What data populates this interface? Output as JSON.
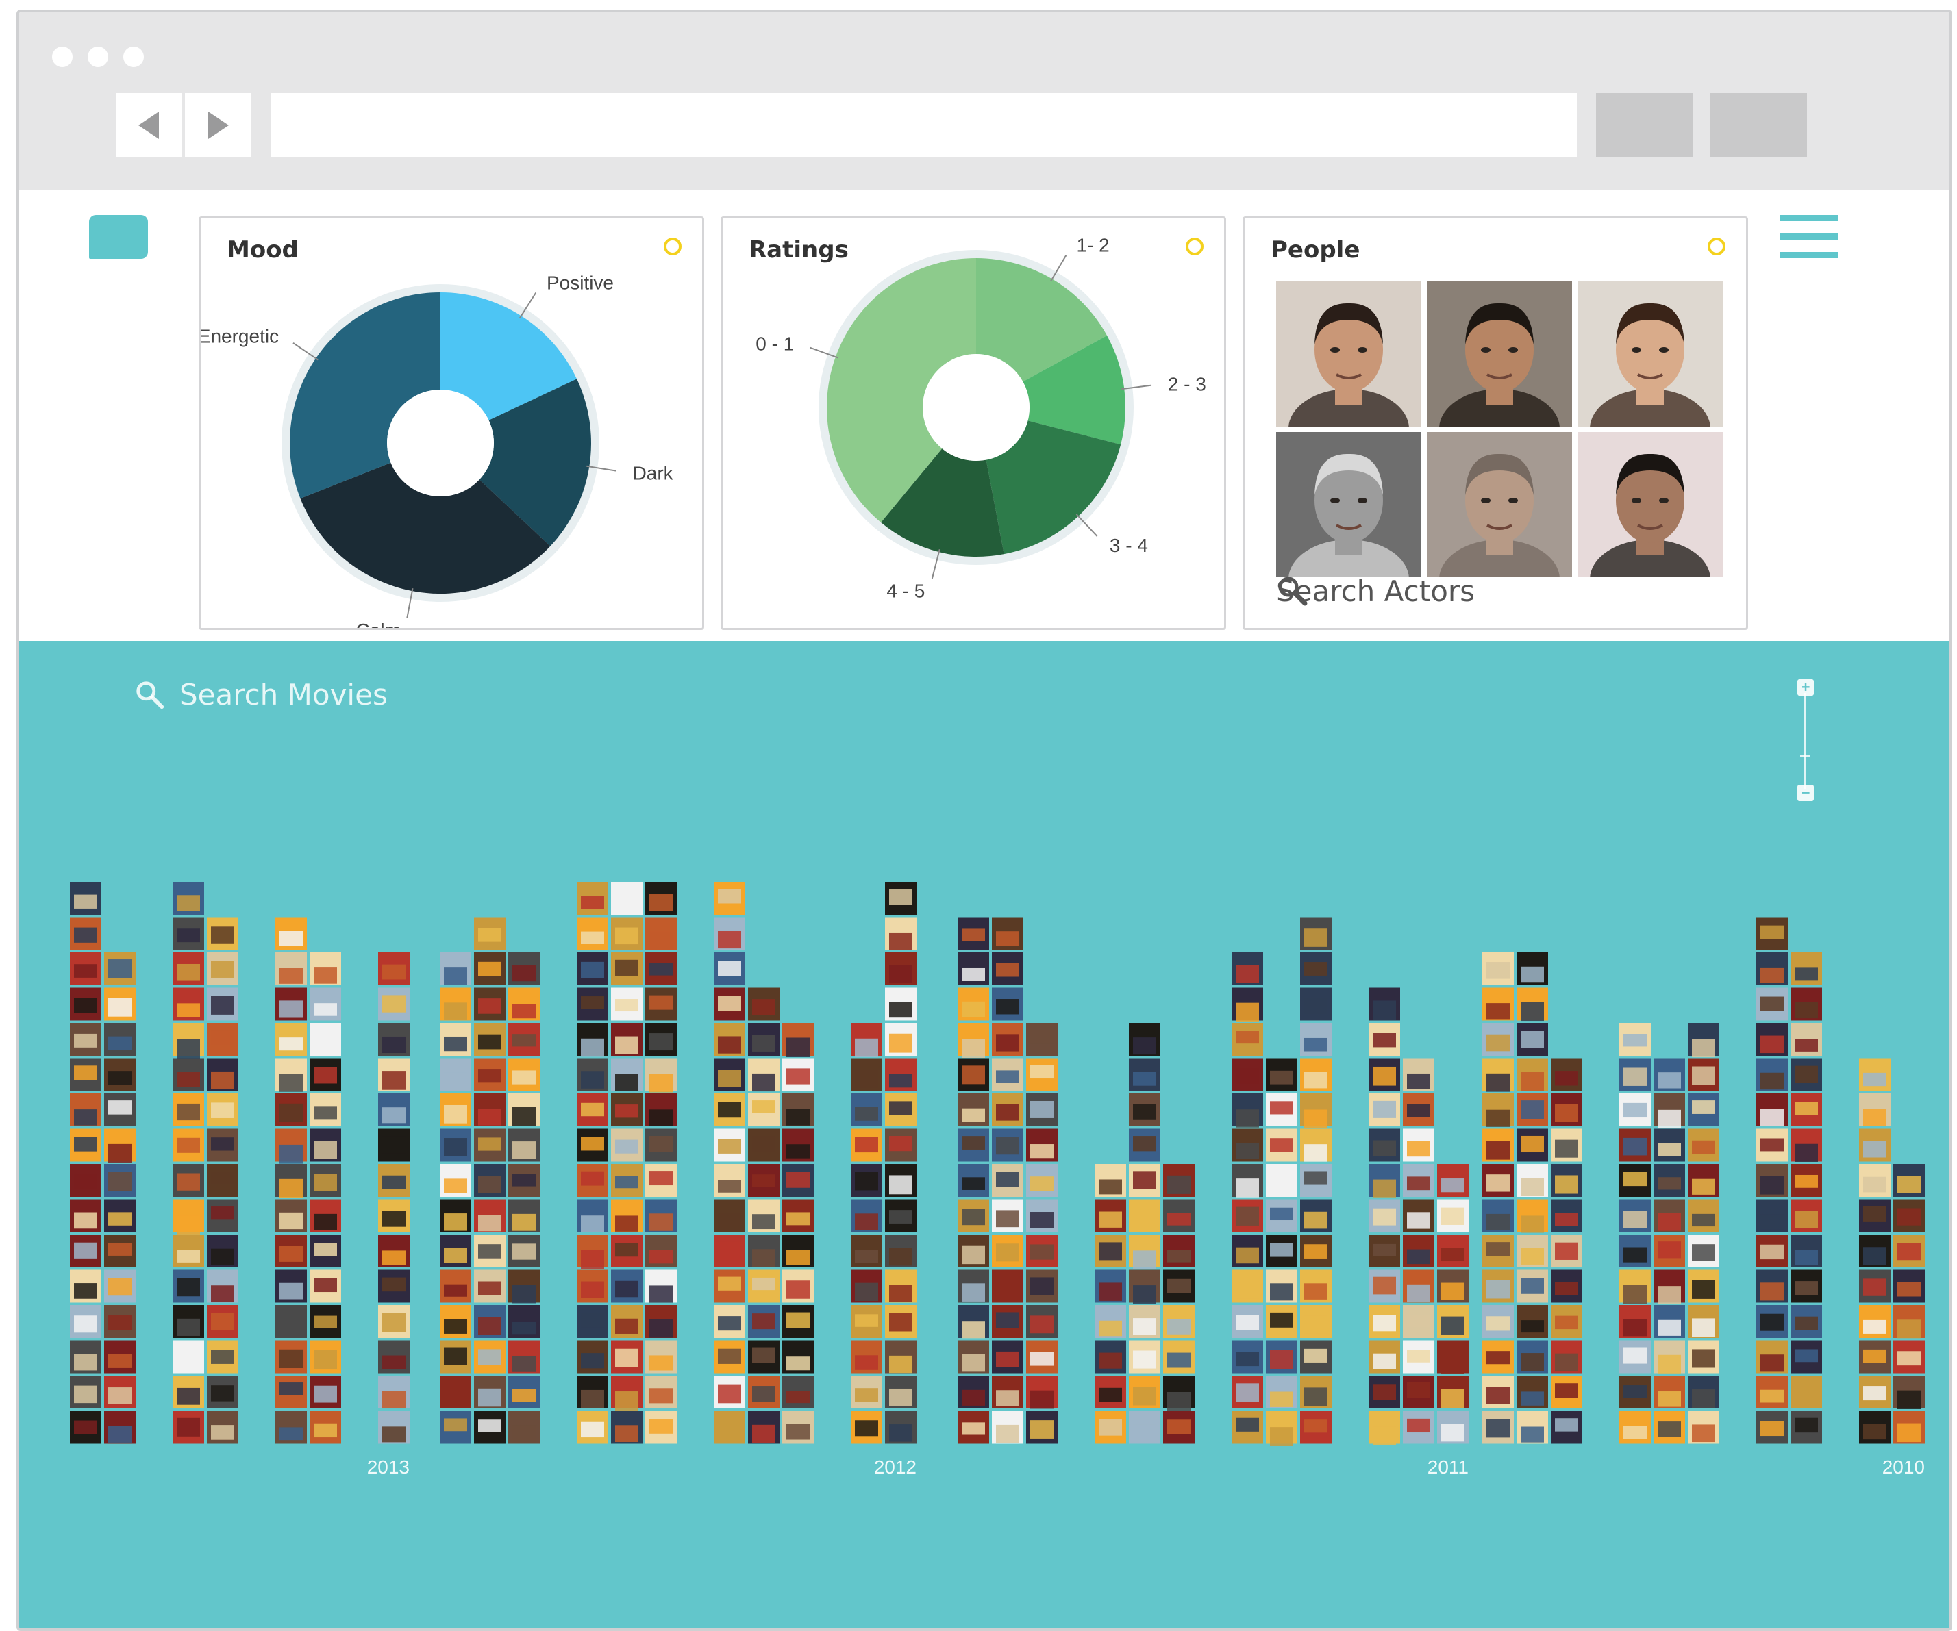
{
  "colors": {
    "teal": "#62c6cb",
    "chrome_bg": "#e6e6e7",
    "ring_yellow": "#f4d11d"
  },
  "browser": {
    "back_icon": "back-arrow-icon",
    "forward_icon": "forward-arrow-icon",
    "url_value": ""
  },
  "panels": {
    "mood": {
      "title": "Mood",
      "chart_data": {
        "type": "pie",
        "labels": [
          "Positive",
          "Dark",
          "Calm",
          "Energetic"
        ],
        "values": [
          18,
          19,
          32,
          31
        ],
        "colors": [
          "#4dc5f4",
          "#1b4a5a",
          "#1b2b35",
          "#24647e"
        ]
      }
    },
    "ratings": {
      "title": "Ratings",
      "chart_data": {
        "type": "pie",
        "labels": [
          "1- 2",
          "2 - 3",
          "3 - 4",
          "4 - 5",
          "0 - 1"
        ],
        "values": [
          17,
          12,
          18,
          14,
          39
        ],
        "colors": [
          "#7dc584",
          "#4fb86e",
          "#2d7b4a",
          "#235d39",
          "#8dcb8c"
        ]
      }
    },
    "people": {
      "title": "People",
      "search_placeholder": "Search Actors",
      "actors": [
        {
          "name": "actor-1",
          "bg": "#d8cfc6",
          "skin": "#c99777",
          "hair": "#2a1e18"
        },
        {
          "name": "actor-2",
          "bg": "#8a8076",
          "skin": "#b78564",
          "hair": "#1d1712"
        },
        {
          "name": "actor-3",
          "bg": "#ded8d0",
          "skin": "#d9ab8a",
          "hair": "#3a2418"
        },
        {
          "name": "actor-4",
          "bg": "#6e6e6e",
          "skin": "#9c9c9c",
          "hair": "#d8d8d8"
        },
        {
          "name": "actor-5",
          "bg": "#a59a92",
          "skin": "#b79a86",
          "hair": "#776a61"
        },
        {
          "name": "actor-6",
          "bg": "#e7dada",
          "skin": "#a57960",
          "hair": "#1a1512"
        }
      ]
    }
  },
  "viz": {
    "search_placeholder": "Search Movies",
    "zoom_in": "+",
    "zoom_out": "−",
    "chart_data": {
      "type": "bar",
      "categories": [
        "2013",
        "2012",
        "2011",
        "2010"
      ],
      "columns_per_year": [
        [
          16,
          14,
          0,
          16,
          15,
          0,
          15,
          14,
          0,
          14
        ],
        [
          14,
          15,
          14,
          0,
          16,
          16,
          16,
          0,
          16,
          13,
          12,
          0,
          12,
          16
        ],
        [
          15,
          15,
          12,
          0,
          8,
          12,
          8,
          0,
          14,
          11,
          15,
          0,
          13,
          11,
          8
        ],
        [
          14,
          14,
          11,
          0,
          12,
          11,
          12,
          0,
          15,
          14,
          0,
          11,
          8
        ]
      ],
      "ylabel": "",
      "xlabel": ""
    }
  }
}
